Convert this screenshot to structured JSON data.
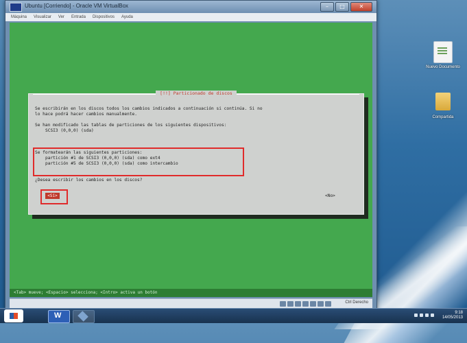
{
  "vm": {
    "title": "Ubuntu [Corriendo] - Oracle VM VirtualBox",
    "menu": [
      "Máquina",
      "Visualizar",
      "Ver",
      "Entrada",
      "Dispositivos",
      "Ayuda"
    ],
    "buttons": {
      "min": "–",
      "max": "□",
      "close": "✕"
    }
  },
  "dialog": {
    "title": "[!!] Particionado de discos",
    "intro_line1": "Se escribirán en los discos todos los cambios indicados a continuación si continúa. Si no",
    "intro_line2": "lo hace podrá hacer cambios manualmente.",
    "modified_line1": "Se han modificado las tablas de particiones de los siguientes dispositivos:",
    "modified_line2": "SCSI3 (0,0,0) (sda)",
    "format_line1": "Se formatearán las siguientes particiones:",
    "format_line2": "partición #1 de SCSI3 (0,0,0) (sda) como ext4",
    "format_line3": "partición #5 de SCSI3 (0,0,0) (sda) como intercambio",
    "question": "¿Desea escribir los cambios en los discos?",
    "yes_label": "<Sí>",
    "no_label": "<No>"
  },
  "status_line": "<Tab> mueve; <Espacio> selecciona; <Intro> activa un botón",
  "vm_hostkey": "Ctrl Derecho",
  "desktop": {
    "icon1_label": "Nuevo Documento",
    "icon2_label": "Compartida"
  },
  "taskbar": {
    "time": "9:18",
    "date": "14/05/2013"
  },
  "colors": {
    "installer_bg": "#44a84e",
    "dialog_bg": "#cfd1cf",
    "highlight": "#e02a2a",
    "title_accent": "#c0392b"
  }
}
